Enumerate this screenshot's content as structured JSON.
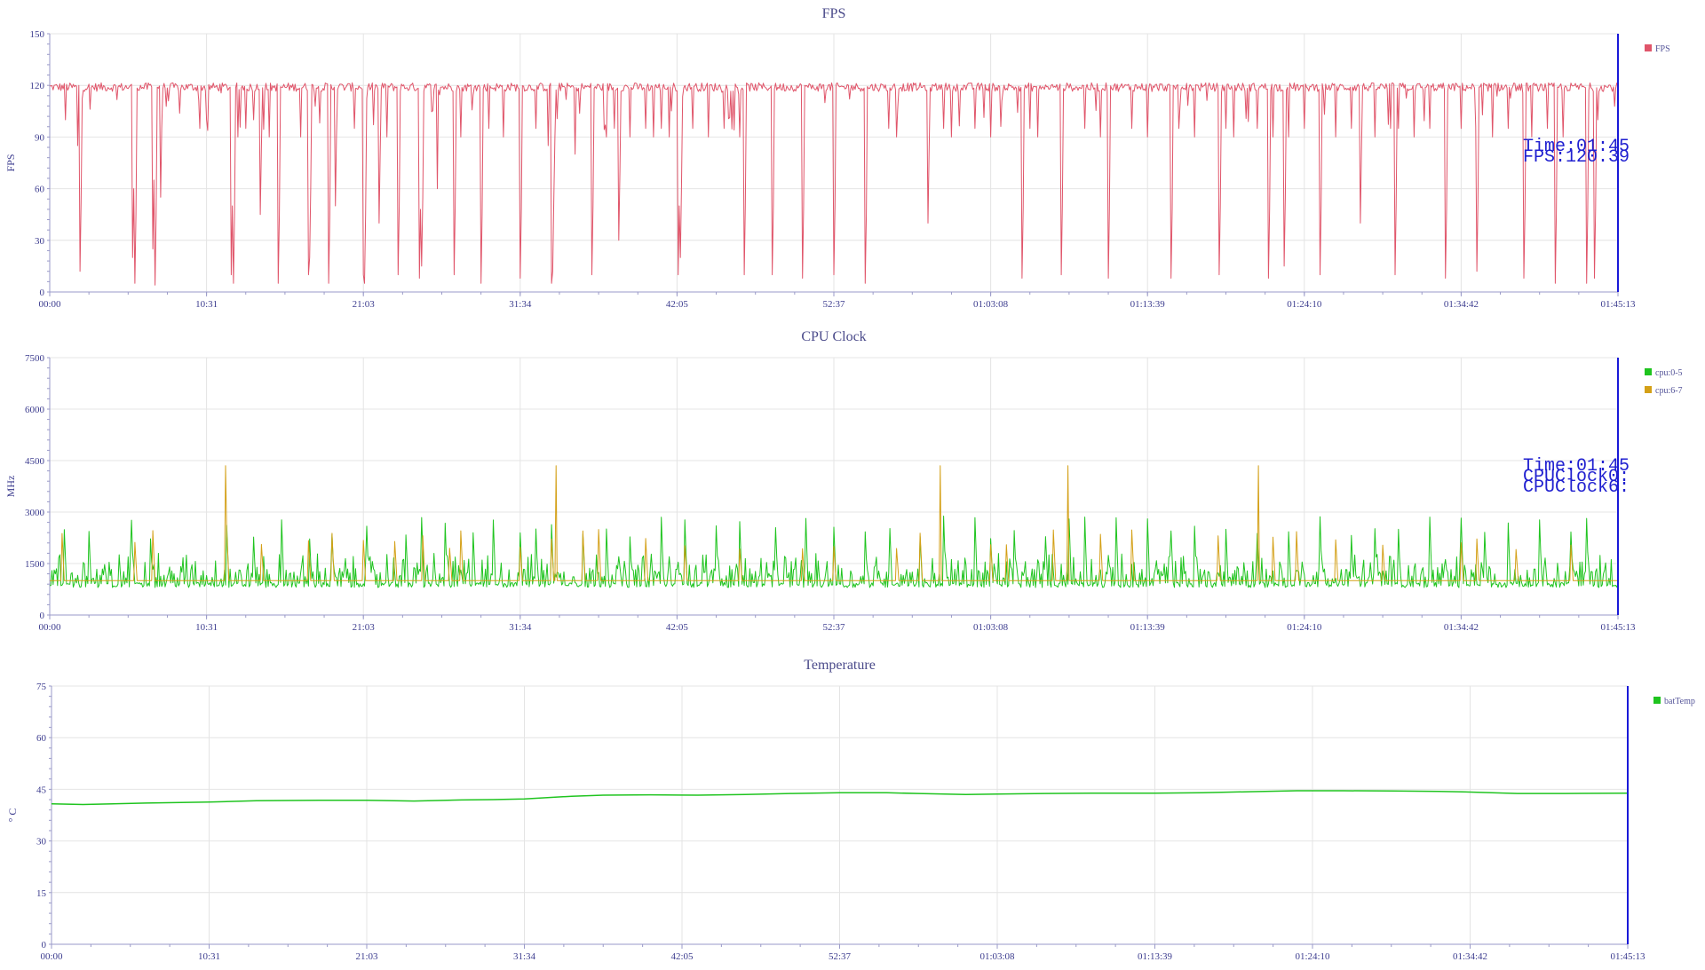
{
  "x_ticks": [
    "00:00",
    "10:31",
    "21:03",
    "31:34",
    "42:05",
    "52:37",
    "01:03:08",
    "01:13:39",
    "01:24:10",
    "01:34:42",
    "01:45:13"
  ],
  "chart_data": [
    {
      "id": "fps",
      "type": "line",
      "title": "FPS",
      "ylabel": "FPS",
      "xlabel": "",
      "ylim": [
        0,
        150
      ],
      "y_ticks": [
        "0",
        "30",
        "60",
        "90",
        "120",
        "150"
      ],
      "grid": true,
      "legend_position": "right",
      "series": [
        {
          "name": "FPS",
          "color": "#e0556a",
          "baseline": 119,
          "noise": 2.5,
          "dips": [
            [
              0.01,
              100
            ],
            [
              0.018,
              85
            ],
            [
              0.019,
              12
            ],
            [
              0.053,
              20
            ],
            [
              0.054,
              5
            ],
            [
              0.066,
              25
            ],
            [
              0.067,
              4
            ],
            [
              0.071,
              55
            ],
            [
              0.096,
              95
            ],
            [
              0.1,
              100
            ],
            [
              0.116,
              10
            ],
            [
              0.117,
              5
            ],
            [
              0.12,
              90
            ],
            [
              0.125,
              95
            ],
            [
              0.13,
              100
            ],
            [
              0.134,
              45
            ],
            [
              0.14,
              90
            ],
            [
              0.146,
              5
            ],
            [
              0.16,
              90
            ],
            [
              0.165,
              10
            ],
            [
              0.166,
              20
            ],
            [
              0.178,
              5
            ],
            [
              0.182,
              50
            ],
            [
              0.194,
              95
            ],
            [
              0.2,
              10
            ],
            [
              0.201,
              5
            ],
            [
              0.21,
              40
            ],
            [
              0.215,
              90
            ],
            [
              0.222,
              10
            ],
            [
              0.236,
              8
            ],
            [
              0.237,
              15
            ],
            [
              0.247,
              60
            ],
            [
              0.258,
              10
            ],
            [
              0.262,
              90
            ],
            [
              0.275,
              5
            ],
            [
              0.28,
              95
            ],
            [
              0.289,
              90
            ],
            [
              0.3,
              8
            ],
            [
              0.31,
              95
            ],
            [
              0.318,
              85
            ],
            [
              0.32,
              5
            ],
            [
              0.3205,
              12
            ],
            [
              0.322,
              90
            ],
            [
              0.335,
              80
            ],
            [
              0.346,
              10
            ],
            [
              0.355,
              90
            ],
            [
              0.36,
              95
            ],
            [
              0.363,
              30
            ],
            [
              0.37,
              90
            ],
            [
              0.38,
              95
            ],
            [
              0.385,
              90
            ],
            [
              0.39,
              95
            ],
            [
              0.395,
              90
            ],
            [
              0.401,
              10
            ],
            [
              0.402,
              20
            ],
            [
              0.41,
              95
            ],
            [
              0.42,
              90
            ],
            [
              0.43,
              95
            ],
            [
              0.44,
              90
            ],
            [
              0.443,
              10
            ],
            [
              0.461,
              10
            ],
            [
              0.48,
              8
            ],
            [
              0.5,
              10
            ],
            [
              0.52,
              5
            ],
            [
              0.535,
              95
            ],
            [
              0.54,
              90
            ],
            [
              0.56,
              40
            ],
            [
              0.57,
              95
            ],
            [
              0.575,
              90
            ],
            [
              0.59,
              95
            ],
            [
              0.6,
              90
            ],
            [
              0.62,
              8
            ],
            [
              0.625,
              95
            ],
            [
              0.63,
              90
            ],
            [
              0.645,
              10
            ],
            [
              0.66,
              95
            ],
            [
              0.67,
              90
            ],
            [
              0.675,
              8
            ],
            [
              0.69,
              95
            ],
            [
              0.7,
              90
            ],
            [
              0.715,
              8
            ],
            [
              0.72,
              95
            ],
            [
              0.73,
              90
            ],
            [
              0.746,
              10
            ],
            [
              0.75,
              95
            ],
            [
              0.755,
              90
            ],
            [
              0.77,
              95
            ],
            [
              0.777,
              8
            ],
            [
              0.78,
              90
            ],
            [
              0.787,
              15
            ],
            [
              0.79,
              90
            ],
            [
              0.8,
              95
            ],
            [
              0.81,
              10
            ],
            [
              0.82,
              90
            ],
            [
              0.83,
              95
            ],
            [
              0.836,
              40
            ],
            [
              0.845,
              90
            ],
            [
              0.855,
              95
            ],
            [
              0.858,
              10
            ],
            [
              0.86,
              95
            ],
            [
              0.87,
              90
            ],
            [
              0.88,
              95
            ],
            [
              0.89,
              8
            ],
            [
              0.9,
              95
            ],
            [
              0.91,
              12
            ],
            [
              0.92,
              90
            ],
            [
              0.93,
              95
            ],
            [
              0.94,
              8
            ],
            [
              0.945,
              90
            ],
            [
              0.955,
              95
            ],
            [
              0.96,
              5
            ],
            [
              0.965,
              90
            ],
            [
              0.98,
              5
            ],
            [
              0.985,
              8
            ],
            [
              0.987,
              100
            ]
          ]
        }
      ],
      "tooltip": [
        "Time:01:45",
        "FPS:120.39"
      ]
    },
    {
      "id": "cpu",
      "type": "line",
      "title": "CPU Clock",
      "ylabel": "MHz",
      "xlabel": "",
      "ylim": [
        0,
        7500
      ],
      "y_ticks": [
        "0",
        "1500",
        "3000",
        "4500",
        "6000",
        "7500"
      ],
      "grid": true,
      "legend_position": "right",
      "series": [
        {
          "name": "cpu:0-5",
          "color": "#1fc41f",
          "baseline": 850,
          "noise": 250,
          "spikes": [
            0.009,
            0.025,
            0.052,
            0.064,
            0.113,
            0.13,
            0.148,
            0.166,
            0.18,
            0.202,
            0.227,
            0.237,
            0.252,
            0.27,
            0.283,
            0.3,
            0.31,
            0.32,
            0.34,
            0.355,
            0.37,
            0.39,
            0.405,
            0.425,
            0.44,
            0.463,
            0.482,
            0.5,
            0.52,
            0.536,
            0.555,
            0.57,
            0.59,
            0.6,
            0.615,
            0.635,
            0.65,
            0.66,
            0.68,
            0.7,
            0.715,
            0.73,
            0.75,
            0.77,
            0.79,
            0.81,
            0.83,
            0.845,
            0.86,
            0.88,
            0.9,
            0.915,
            0.93,
            0.95,
            0.97,
            0.98
          ],
          "spike_max": 2900
        },
        {
          "name": "cpu:6-7",
          "color": "#d4a017",
          "baseline": 1000,
          "noise": 0,
          "spikes": [
            0.008,
            0.054,
            0.066,
            0.113,
            0.135,
            0.165,
            0.18,
            0.2,
            0.22,
            0.238,
            0.255,
            0.262,
            0.3,
            0.32,
            0.34,
            0.35,
            0.38,
            0.405,
            0.44,
            0.48,
            0.5,
            0.54,
            0.555,
            0.6,
            0.61,
            0.64,
            0.67,
            0.69,
            0.745,
            0.78,
            0.795,
            0.82,
            0.85,
            0.9,
            0.91,
            0.935,
            0.97
          ],
          "spike_max": 2500,
          "tall_spikes": [
            0.112,
            0.323,
            0.568,
            0.649,
            0.771
          ],
          "tall_max": 4350
        }
      ],
      "tooltip": [
        "Time:01:45",
        "CPUClock0:",
        "CPUClock6:"
      ]
    },
    {
      "id": "temp",
      "type": "line",
      "title": "Temperature",
      "ylabel": "° C",
      "xlabel": "",
      "ylim": [
        0,
        75
      ],
      "y_ticks": [
        "0",
        "15",
        "30",
        "45",
        "60",
        "75"
      ],
      "grid": true,
      "legend_position": "right",
      "series": [
        {
          "name": "batTemp",
          "color": "#1fc41f",
          "points": [
            [
              0,
              40.8
            ],
            [
              0.02,
              40.6
            ],
            [
              0.06,
              41.0
            ],
            [
              0.1,
              41.3
            ],
            [
              0.13,
              41.7
            ],
            [
              0.17,
              41.8
            ],
            [
              0.2,
              41.8
            ],
            [
              0.23,
              41.6
            ],
            [
              0.26,
              41.9
            ],
            [
              0.28,
              42.0
            ],
            [
              0.3,
              42.2
            ],
            [
              0.33,
              43.0
            ],
            [
              0.35,
              43.3
            ],
            [
              0.38,
              43.4
            ],
            [
              0.41,
              43.3
            ],
            [
              0.44,
              43.5
            ],
            [
              0.47,
              43.8
            ],
            [
              0.5,
              44.0
            ],
            [
              0.53,
              44.0
            ],
            [
              0.55,
              43.8
            ],
            [
              0.58,
              43.5
            ],
            [
              0.6,
              43.6
            ],
            [
              0.63,
              43.8
            ],
            [
              0.66,
              43.9
            ],
            [
              0.7,
              43.9
            ],
            [
              0.73,
              44.0
            ],
            [
              0.76,
              44.3
            ],
            [
              0.79,
              44.6
            ],
            [
              0.82,
              44.6
            ],
            [
              0.85,
              44.5
            ],
            [
              0.88,
              44.4
            ],
            [
              0.9,
              44.2
            ],
            [
              0.93,
              43.8
            ],
            [
              0.96,
              43.8
            ],
            [
              1.0,
              43.9
            ]
          ]
        }
      ],
      "tooltip": []
    }
  ]
}
